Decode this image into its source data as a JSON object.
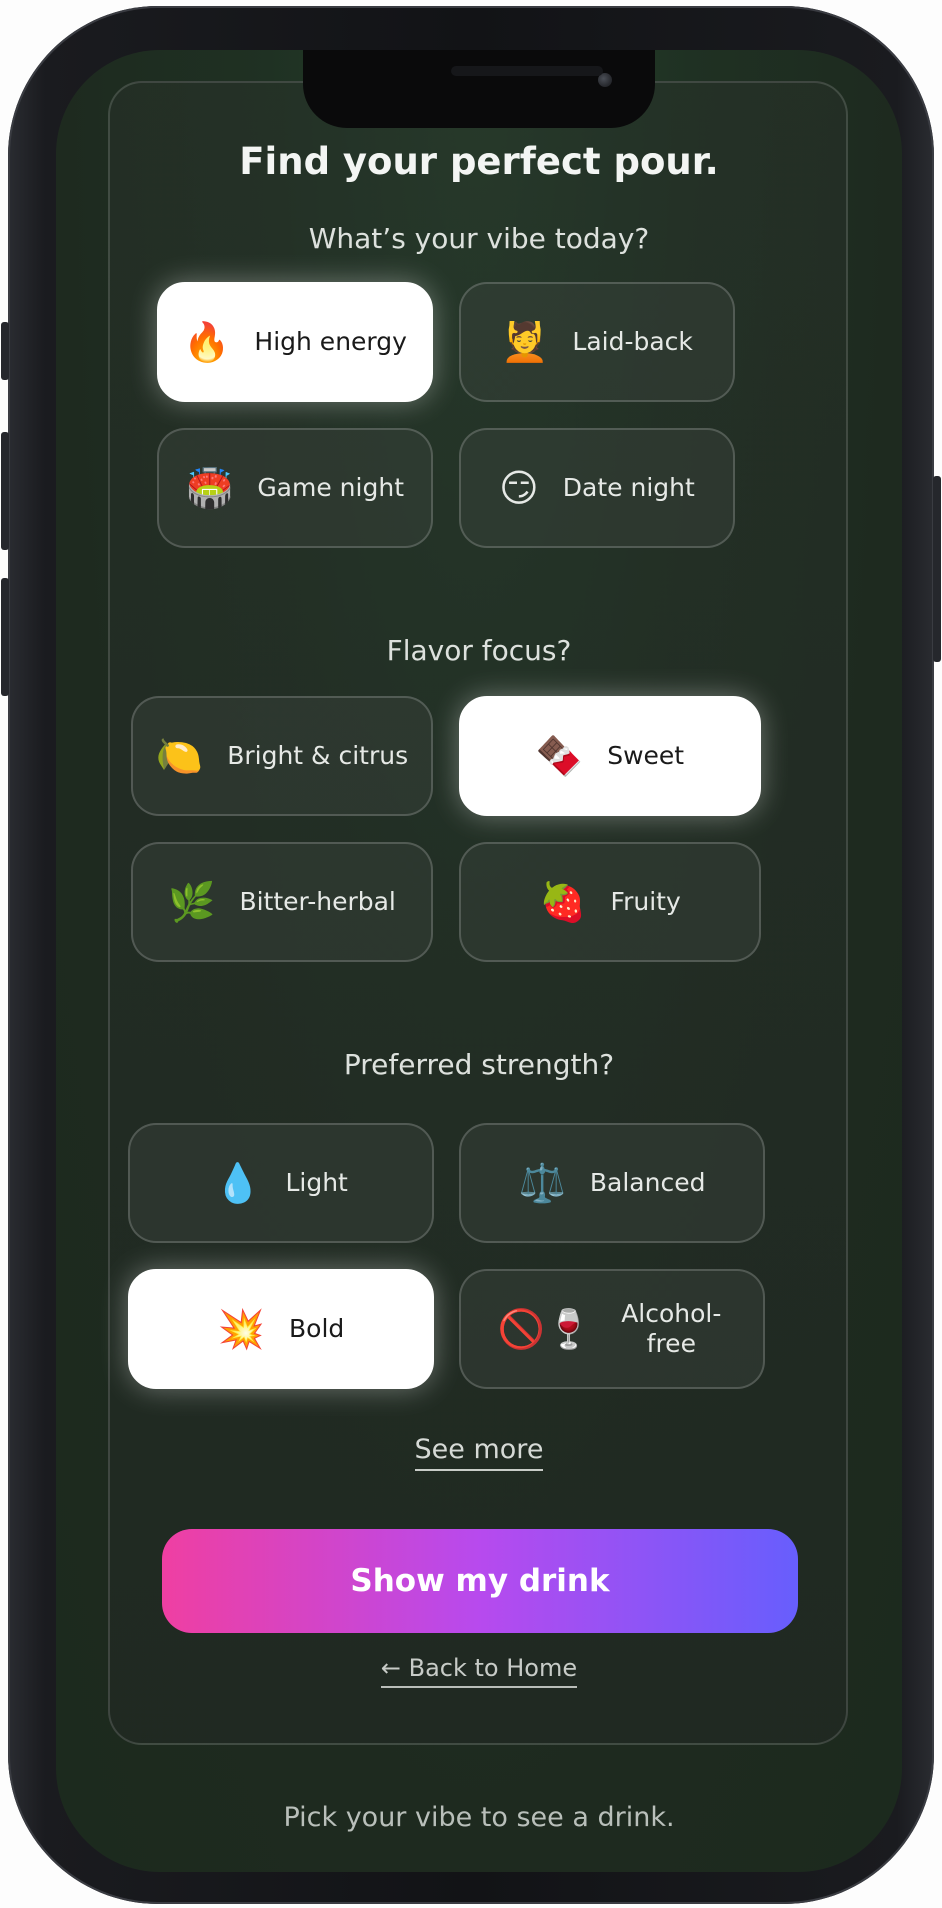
{
  "title": "Find your perfect pour.",
  "sections": {
    "vibe": {
      "title": "What’s your vibe today?",
      "options": [
        {
          "emoji": "🔥",
          "label": "High energy",
          "selected": true
        },
        {
          "emoji": "💆",
          "label": "Laid-back",
          "selected": false
        },
        {
          "emoji": "🏟️",
          "label": "Game night",
          "selected": false
        },
        {
          "emoji": "😏",
          "label": "Date night",
          "selected": false
        }
      ]
    },
    "flavor": {
      "title": "Flavor focus?",
      "options": [
        {
          "emoji": "🍋",
          "label": "Bright & citrus",
          "selected": false
        },
        {
          "emoji": "🍫",
          "label": "Sweet",
          "selected": true
        },
        {
          "emoji": "🌿",
          "label": "Bitter-herbal",
          "selected": false
        },
        {
          "emoji": "🍓",
          "label": "Fruity",
          "selected": false
        }
      ]
    },
    "strength": {
      "title": "Preferred strength?",
      "options": [
        {
          "emoji": "💧",
          "label": "Light",
          "selected": false
        },
        {
          "emoji": "⚖️",
          "label": "Balanced",
          "selected": false
        },
        {
          "emoji": "💥",
          "label": "Bold",
          "selected": true
        },
        {
          "emoji": "🚫🍷",
          "label": "Alcohol-free",
          "selected": false
        }
      ]
    }
  },
  "see_more": "See more",
  "cta_label": "Show my drink",
  "back_label": "← Back to Home",
  "footer_text": "Pick your vibe to see a drink.",
  "colors": {
    "background": "#1e2a1f",
    "selected": "#ffffff",
    "cta_start": "#ef3fa2",
    "cta_mid": "#b74aee",
    "cta_end": "#675efd"
  }
}
